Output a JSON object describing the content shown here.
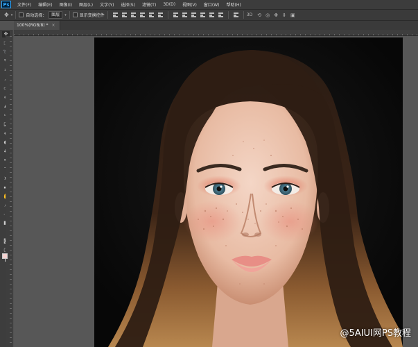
{
  "app": {
    "logo": "Ps"
  },
  "menu": [
    "文件(F)",
    "编辑(E)",
    "图像(I)",
    "图层(L)",
    "文字(Y)",
    "选择(S)",
    "滤镜(T)",
    "3D(D)",
    "视图(V)",
    "窗口(W)",
    "帮助(H)"
  ],
  "options": {
    "auto_select_label": "自动选择：",
    "auto_select_value": "图层",
    "show_transform_label": "显示变换控件"
  },
  "document": {
    "tab_title": "100%(RGB/8) *",
    "close_glyph": "×"
  },
  "watermark": "@5AIUI网PS教程",
  "colors": {
    "foreground": "#f4d2d0",
    "background": "#111111"
  }
}
